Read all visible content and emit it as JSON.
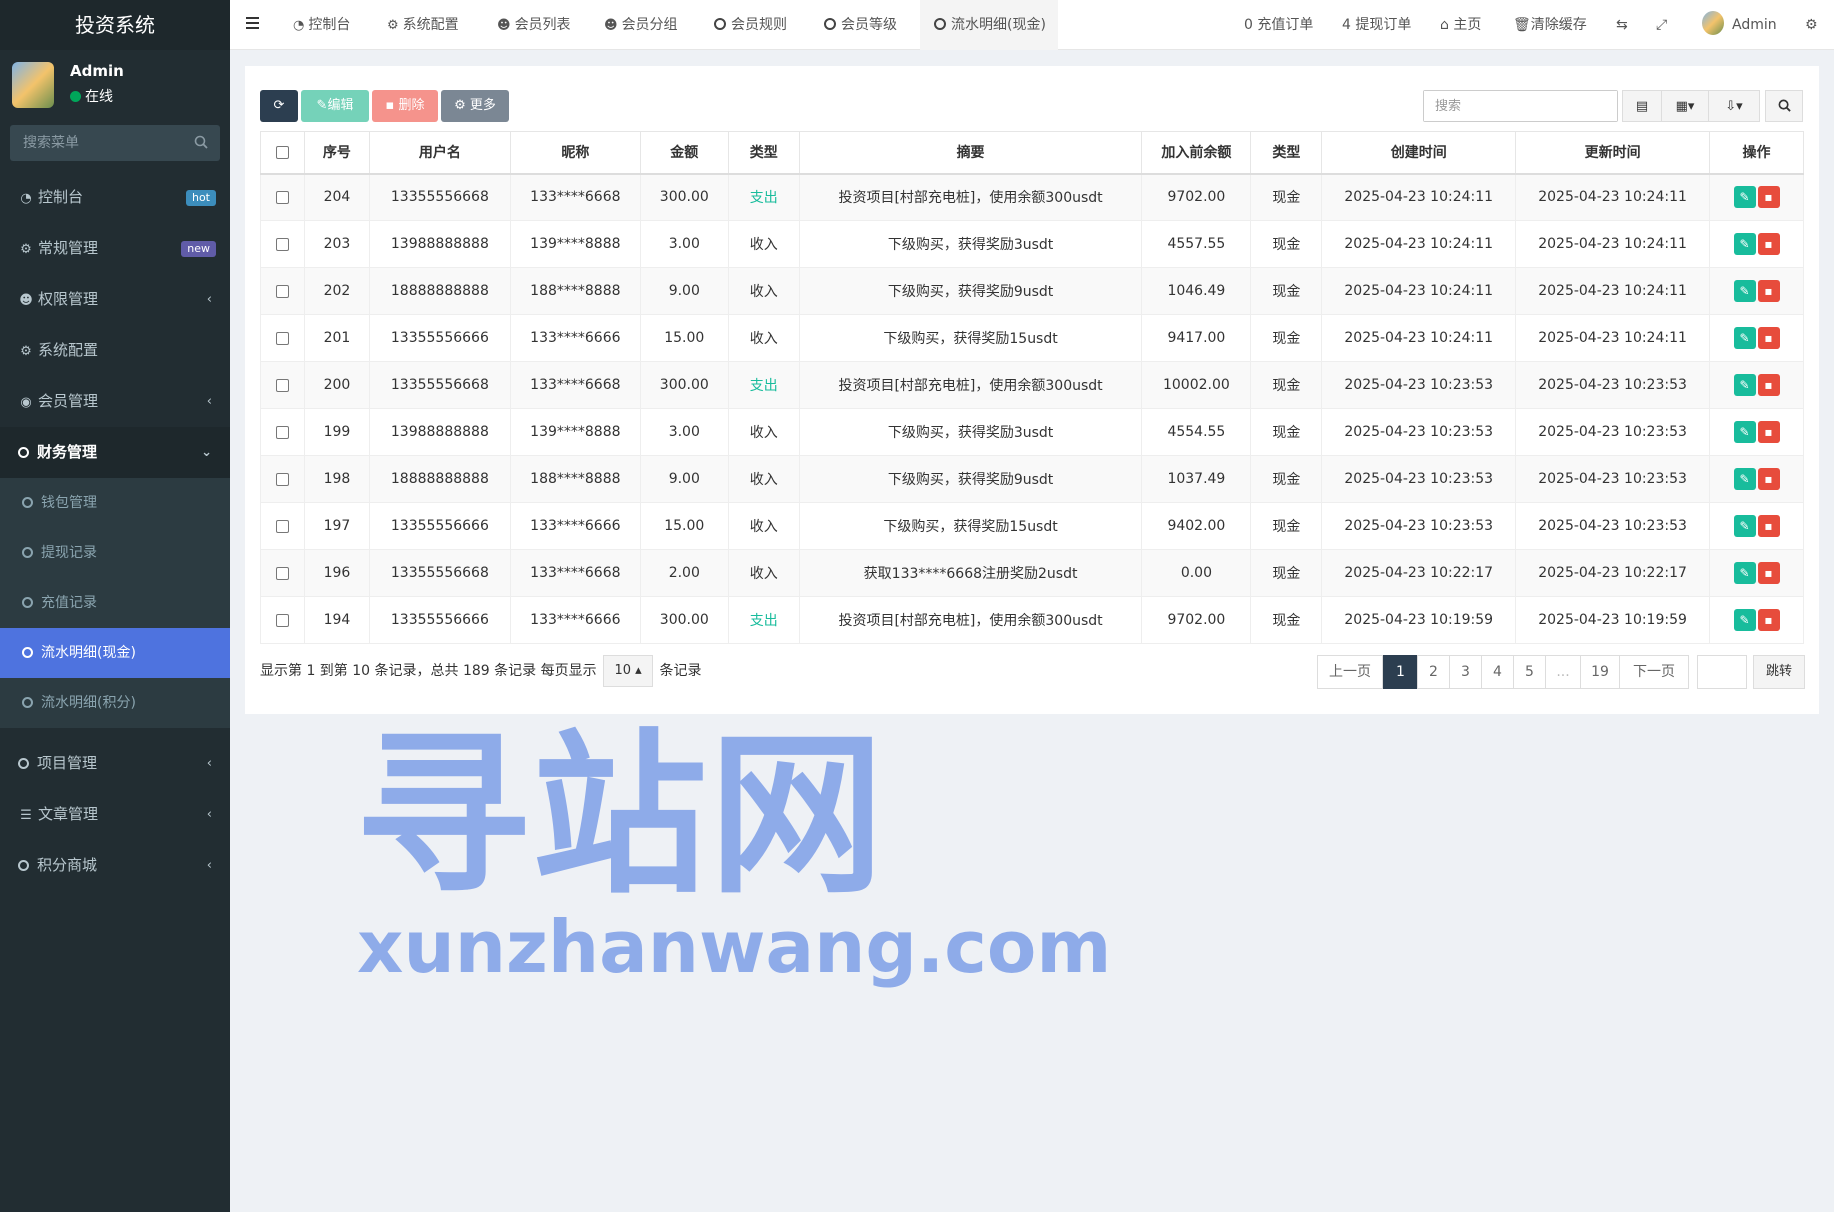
{
  "app": {
    "title": "投资系统"
  },
  "user": {
    "name": "Admin",
    "status": "在线"
  },
  "sidebar": {
    "search_placeholder": "搜索菜单",
    "items": [
      {
        "label": "控制台",
        "icon": "dashboard-icon",
        "badge": "hot"
      },
      {
        "label": "常规管理",
        "icon": "cogs-icon",
        "badge": "new"
      },
      {
        "label": "权限管理",
        "icon": "group-icon"
      },
      {
        "label": "系统配置",
        "icon": "gear-icon"
      },
      {
        "label": "会员管理",
        "icon": "user-circle-icon"
      },
      {
        "label": "财务管理",
        "icon": "circle-icon"
      }
    ],
    "finance_sub": [
      {
        "label": "钱包管理"
      },
      {
        "label": "提现记录"
      },
      {
        "label": "充值记录"
      },
      {
        "label": "流水明细(现金)",
        "active": true
      },
      {
        "label": "流水明细(积分)"
      }
    ],
    "bottom_items": [
      {
        "label": "项目管理",
        "icon": "circle-icon"
      },
      {
        "label": "文章管理",
        "icon": "list-icon"
      },
      {
        "label": "积分商城",
        "icon": "circle-icon"
      }
    ]
  },
  "topbar": {
    "tabs": [
      {
        "label": "控制台"
      },
      {
        "label": "系统配置"
      },
      {
        "label": "会员列表"
      },
      {
        "label": "会员分组"
      },
      {
        "label": "会员规则"
      },
      {
        "label": "会员等级"
      },
      {
        "label": "流水明细(现金)"
      }
    ],
    "recharge_orders": "0 充值订单",
    "withdraw_orders": "4 提现订单",
    "home": "主页",
    "clear_cache": "清除缓存",
    "user": "Admin"
  },
  "toolbar": {
    "edit_label": "编辑",
    "delete_label": "删除",
    "more_label": "更多",
    "search_placeholder": "搜索"
  },
  "table": {
    "headers": [
      "序号",
      "用户名",
      "昵称",
      "金额",
      "类型",
      "摘要",
      "加入前余额",
      "类型",
      "创建时间",
      "更新时间",
      "操作"
    ],
    "rows": [
      [
        "204",
        "13355556668",
        "133****6668",
        "300.00",
        "支出",
        "投资项目[村部充电桩]，使用余额300usdt",
        "9702.00",
        "现金",
        "2025-04-23 10:24:11",
        "2025-04-23 10:24:11"
      ],
      [
        "203",
        "13988888888",
        "139****8888",
        "3.00",
        "收入",
        "下级购买，获得奖励3usdt",
        "4557.55",
        "现金",
        "2025-04-23 10:24:11",
        "2025-04-23 10:24:11"
      ],
      [
        "202",
        "18888888888",
        "188****8888",
        "9.00",
        "收入",
        "下级购买，获得奖励9usdt",
        "1046.49",
        "现金",
        "2025-04-23 10:24:11",
        "2025-04-23 10:24:11"
      ],
      [
        "201",
        "13355556666",
        "133****6666",
        "15.00",
        "收入",
        "下级购买，获得奖励15usdt",
        "9417.00",
        "现金",
        "2025-04-23 10:24:11",
        "2025-04-23 10:24:11"
      ],
      [
        "200",
        "13355556668",
        "133****6668",
        "300.00",
        "支出",
        "投资项目[村部充电桩]，使用余额300usdt",
        "10002.00",
        "现金",
        "2025-04-23 10:23:53",
        "2025-04-23 10:23:53"
      ],
      [
        "199",
        "13988888888",
        "139****8888",
        "3.00",
        "收入",
        "下级购买，获得奖励3usdt",
        "4554.55",
        "现金",
        "2025-04-23 10:23:53",
        "2025-04-23 10:23:53"
      ],
      [
        "198",
        "18888888888",
        "188****8888",
        "9.00",
        "收入",
        "下级购买，获得奖励9usdt",
        "1037.49",
        "现金",
        "2025-04-23 10:23:53",
        "2025-04-23 10:23:53"
      ],
      [
        "197",
        "13355556666",
        "133****6666",
        "15.00",
        "收入",
        "下级购买，获得奖励15usdt",
        "9402.00",
        "现金",
        "2025-04-23 10:23:53",
        "2025-04-23 10:23:53"
      ],
      [
        "196",
        "13355556668",
        "133****6668",
        "2.00",
        "收入",
        "获取133****6668注册奖励2usdt",
        "0.00",
        "现金",
        "2025-04-23 10:22:17",
        "2025-04-23 10:22:17"
      ],
      [
        "194",
        "13355556666",
        "133****6666",
        "300.00",
        "支出",
        "投资项目[村部充电桩]，使用余额300usdt",
        "9702.00",
        "现金",
        "2025-04-23 10:19:59",
        "2025-04-23 10:19:59"
      ]
    ]
  },
  "footer": {
    "info_prefix": "显示第 1 到第 10 条记录，总共 189 条记录 每页显示",
    "page_size": "10",
    "info_suffix": "条记录",
    "prev": "上一页",
    "next": "下一页",
    "pages": [
      "1",
      "2",
      "3",
      "4",
      "5",
      "...",
      "19"
    ],
    "jump": "跳转"
  },
  "watermark": {
    "cn": "寻站网",
    "en": "xunzhanwang.com"
  },
  "colors": {
    "sidebar_bg": "#222d32",
    "active_item": "#4e73df",
    "expense": "#18bc9c",
    "edit": "#18bc9c",
    "delete": "#e74c3c"
  }
}
